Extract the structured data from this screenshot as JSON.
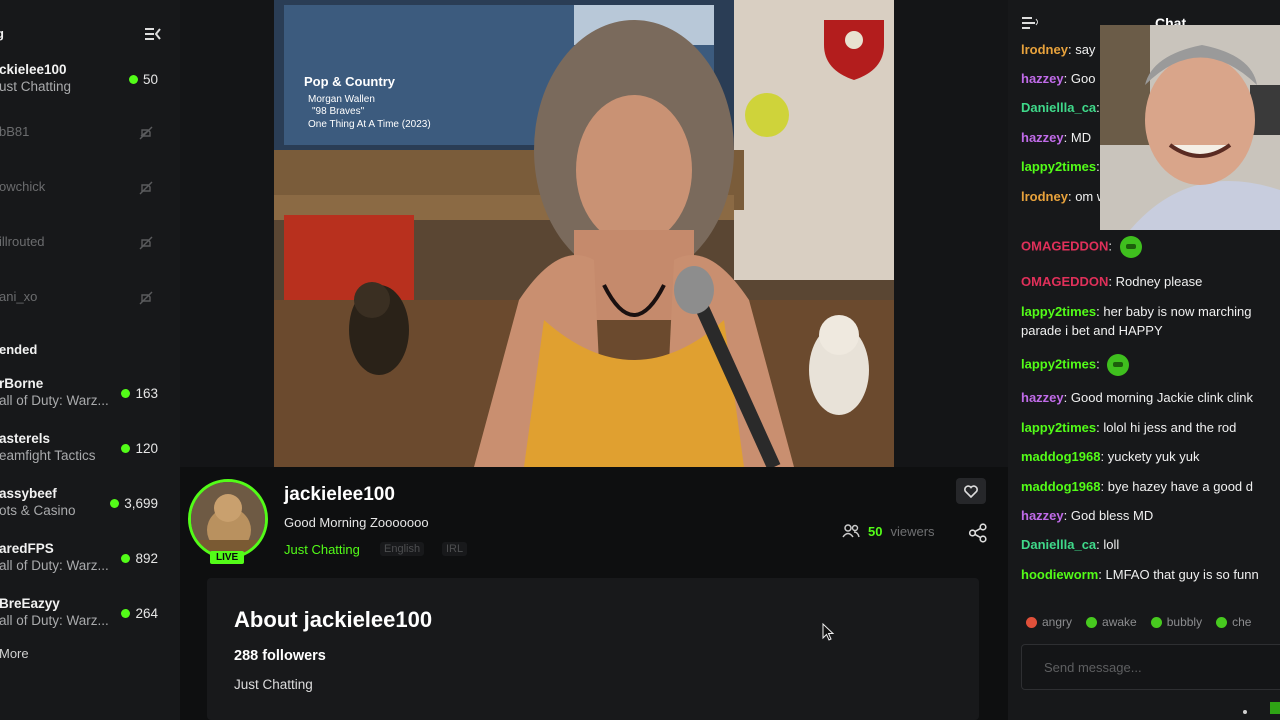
{
  "sidebar": {
    "title": "g",
    "channels": [
      {
        "name": "ckielee100",
        "game": "ust Chatting",
        "viewers": "50",
        "live": true
      },
      {
        "name": "bB81",
        "live": false
      },
      {
        "name": "owchick",
        "live": false
      },
      {
        "name": "illrouted",
        "live": false
      },
      {
        "name": "ani_xo",
        "live": false
      }
    ],
    "recommended_label": "ended",
    "recommended": [
      {
        "name": "rBorne",
        "game": "all of Duty: Warz...",
        "viewers": "163"
      },
      {
        "name": "asterels",
        "game": "eamfight Tactics",
        "viewers": "120"
      },
      {
        "name": "assybeef",
        "game": "ots & Casino",
        "viewers": "3,699"
      },
      {
        "name": "aredFPS",
        "game": "all of Duty: Warz...",
        "viewers": "892"
      },
      {
        "name": "BreEazyy",
        "game": "all of Duty: Warz...",
        "viewers": "264"
      }
    ],
    "more_label": "More"
  },
  "stream": {
    "channel_name": "jackielee100",
    "title": "Good Morning Zooooooo",
    "category": "Just Chatting",
    "tags": [
      "English",
      "IRL"
    ],
    "live_badge": "LIVE",
    "viewer_count": "50",
    "viewer_label": "viewers",
    "tv_overlay": {
      "line1": "Pop & Country",
      "line2": "Morgan Wallen",
      "line3": "\"98 Braves\"",
      "line4": "One Thing At A Time (2023)"
    }
  },
  "about": {
    "heading": "About jackielee100",
    "followers": "288 followers",
    "category": "Just Chatting"
  },
  "chat": {
    "title": "Chat",
    "messages": [
      {
        "user": "lrodney",
        "color": "#e8a23c",
        "text": "say"
      },
      {
        "user": "hazzey",
        "color": "#c06be8",
        "text": "Goo"
      },
      {
        "user": "Daniellla_ca",
        "color": "#3fd98a",
        "text": ""
      },
      {
        "user": "hazzey",
        "color": "#c06be8",
        "text": "MD"
      },
      {
        "user": "lappy2times",
        "color": "#53fc18",
        "text": ""
      },
      {
        "user": "lrodney",
        "color": "#e8a23c",
        "text": "om white baby f"
      },
      {
        "user": "OMAGEDDON",
        "color": "#e0305a",
        "text": "",
        "emote": true
      },
      {
        "user": "OMAGEDDON",
        "color": "#e0305a",
        "text": "Rodney please"
      },
      {
        "user": "lappy2times",
        "color": "#53fc18",
        "text": "her baby is now marching parade i bet and HAPPY"
      },
      {
        "user": "lappy2times",
        "color": "#53fc18",
        "text": "",
        "emote": true
      },
      {
        "user": "hazzey",
        "color": "#c06be8",
        "text": "Good morning Jackie clink clink"
      },
      {
        "user": "lappy2times",
        "color": "#53fc18",
        "text": "lolol hi jess and the rod"
      },
      {
        "user": "maddog1968",
        "color": "#53fc18",
        "text": "yuckety yuk yuk"
      },
      {
        "user": "maddog1968",
        "color": "#53fc18",
        "text": "bye hazey have a good d"
      },
      {
        "user": "hazzey",
        "color": "#c06be8",
        "text": "God bless MD"
      },
      {
        "user": "Daniellla_ca",
        "color": "#3fd98a",
        "text": "loll"
      },
      {
        "user": "hoodieworm",
        "color": "#53fc18",
        "text": "LMFAO that guy is so funn"
      }
    ],
    "emote_chips": [
      "angry",
      "awake",
      "bubbly",
      "che"
    ],
    "input_placeholder": "Send message..."
  },
  "colors": {
    "accent": "#53fc18",
    "background": "#0b0c0d",
    "panel": "#17181a"
  }
}
